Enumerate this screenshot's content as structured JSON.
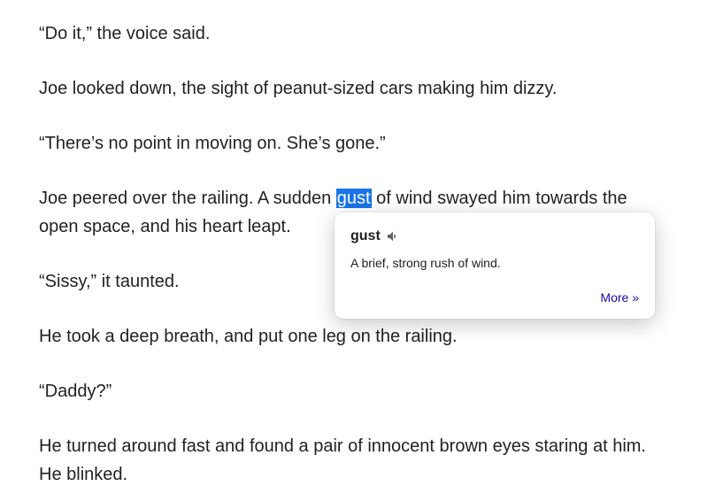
{
  "paragraphs": {
    "p1": "“Do it,” the voice said.",
    "p2": "Joe looked down, the sight of peanut-sized cars making him dizzy.",
    "p3": "“There’s no point in moving on. She’s gone.”",
    "p4_pre": "Joe peered over the railing. A sudden ",
    "p4_hl": "gust",
    "p4_post": " of wind swayed him towards the open space, and his heart leapt.",
    "p5": "“Sissy,” it taunted.",
    "p6": "He took a deep breath, and put one leg on the railing.",
    "p7": "“Daddy?”",
    "p8": "He turned around fast and found a pair of innocent brown eyes staring at him. He blinked."
  },
  "popup": {
    "word": "gust",
    "definition": "A brief, strong rush of wind.",
    "more_label": "More »"
  }
}
